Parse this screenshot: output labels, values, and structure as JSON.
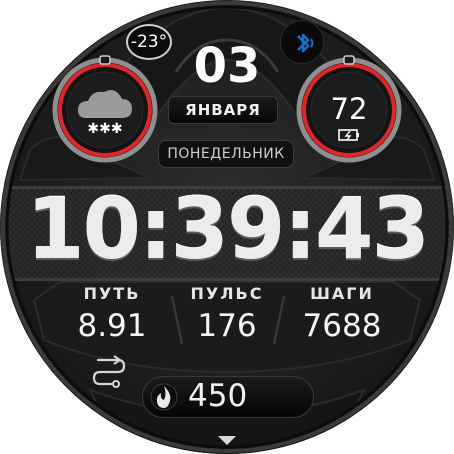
{
  "weather": {
    "temperature": "-23°",
    "icon": "snow-cloud-icon"
  },
  "bluetooth": {
    "icon": "bluetooth-icon",
    "color": "#1e6cc8"
  },
  "date": {
    "day": "03",
    "month": "ЯНВАРЯ",
    "weekday": "ПОНЕДЕЛЬНИК"
  },
  "battery": {
    "value": "72",
    "icon": "battery-charging-icon",
    "level": 0.72
  },
  "time": {
    "display": "10:39:43"
  },
  "stats": [
    {
      "label": "ПУТЬ",
      "value": "8.91"
    },
    {
      "label": "ПУЛЬС",
      "value": "176"
    },
    {
      "label": "ШАГИ",
      "value": "7688"
    }
  ],
  "route_icon": "route-icon",
  "calories": {
    "value": "450",
    "icon": "flame-icon"
  },
  "menu_indicator": "chevron-down-icon",
  "colors": {
    "accent": "#e0262a",
    "ring": "#bdbdbd",
    "background": "#1d1d1d"
  }
}
